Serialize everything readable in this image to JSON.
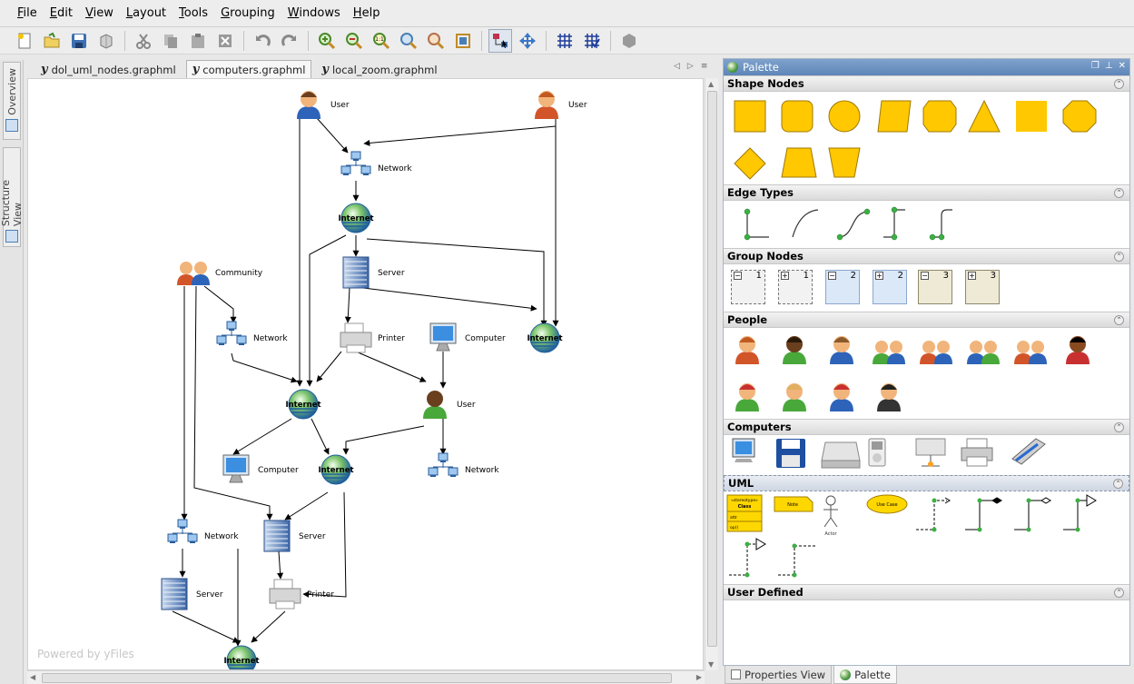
{
  "menu": [
    {
      "key": "F",
      "rest": "ile"
    },
    {
      "key": "E",
      "rest": "dit"
    },
    {
      "key": "V",
      "rest": "iew"
    },
    {
      "key": "L",
      "rest": "ayout"
    },
    {
      "key": "T",
      "rest": "ools"
    },
    {
      "key": "G",
      "rest": "rouping"
    },
    {
      "key": "W",
      "rest": "indows"
    },
    {
      "key": "H",
      "rest": "elp"
    }
  ],
  "side_tabs": {
    "overview": "Overview",
    "structure": "Structure View"
  },
  "doc_tabs": [
    {
      "label": "dol_uml_nodes.graphml",
      "active": false
    },
    {
      "label": "computers.graphml",
      "active": true
    },
    {
      "label": "local_zoom.graphml",
      "active": false
    }
  ],
  "tab_nav": {
    "prev": "◁",
    "next": "▷",
    "list": "≡"
  },
  "canvas": {
    "watermark": "Powered by yFiles",
    "nodes": [
      {
        "id": "user1",
        "icon": "person-blue-icon",
        "label": "User"
      },
      {
        "id": "user2",
        "icon": "person-orange-icon",
        "label": "User"
      },
      {
        "id": "net1",
        "icon": "network-icon",
        "label": "Network"
      },
      {
        "id": "inet1",
        "icon": "globe-icon",
        "label": "Internet"
      },
      {
        "id": "community",
        "icon": "people-icon",
        "label": "Community"
      },
      {
        "id": "server1",
        "icon": "server-icon",
        "label": "Server"
      },
      {
        "id": "net2",
        "icon": "network-icon",
        "label": "Network"
      },
      {
        "id": "printer1",
        "icon": "printer-icon",
        "label": "Printer"
      },
      {
        "id": "comp1",
        "icon": "monitor-icon",
        "label": "Computer"
      },
      {
        "id": "inet2",
        "icon": "globe-icon",
        "label": "Internet"
      },
      {
        "id": "inet3",
        "icon": "globe-icon",
        "label": "Internet"
      },
      {
        "id": "user3",
        "icon": "person-green-icon",
        "label": "User"
      },
      {
        "id": "comp2",
        "icon": "monitor-icon",
        "label": "Computer"
      },
      {
        "id": "inet4",
        "icon": "globe-icon",
        "label": "Internet"
      },
      {
        "id": "net3",
        "icon": "network-icon",
        "label": "Network"
      },
      {
        "id": "net4",
        "icon": "network-icon",
        "label": "Network"
      },
      {
        "id": "server2",
        "icon": "server-icon",
        "label": "Server"
      },
      {
        "id": "server3",
        "icon": "server-icon",
        "label": "Server"
      },
      {
        "id": "printer2",
        "icon": "printer-icon",
        "label": "Printer"
      },
      {
        "id": "inet5",
        "icon": "globe-icon",
        "label": "Internet"
      }
    ]
  },
  "palette": {
    "title": "Palette",
    "sections": {
      "shape_nodes": "Shape Nodes",
      "edge_types": "Edge Types",
      "group_nodes": "Group Nodes",
      "people": "People",
      "computers": "Computers",
      "uml": "UML",
      "user_defined": "User Defined"
    },
    "group_nodes": [
      "1",
      "1",
      "2",
      "2",
      "3",
      "3"
    ],
    "uml": {
      "class_stereo": "«stereotype»",
      "class_name": "Class",
      "class_attr": "attr",
      "class_op": "op()",
      "note": "Note",
      "actor": "Actor",
      "use_case": "Use Case"
    }
  },
  "bottom_tabs": [
    {
      "label": "Properties View",
      "active": false
    },
    {
      "label": "Palette",
      "active": true
    }
  ],
  "colors": {
    "shape_fill": "#ffc800",
    "shape_stroke": "#a07800",
    "title_bar": "#6a8fbf",
    "edge_node": "#3cb043"
  }
}
